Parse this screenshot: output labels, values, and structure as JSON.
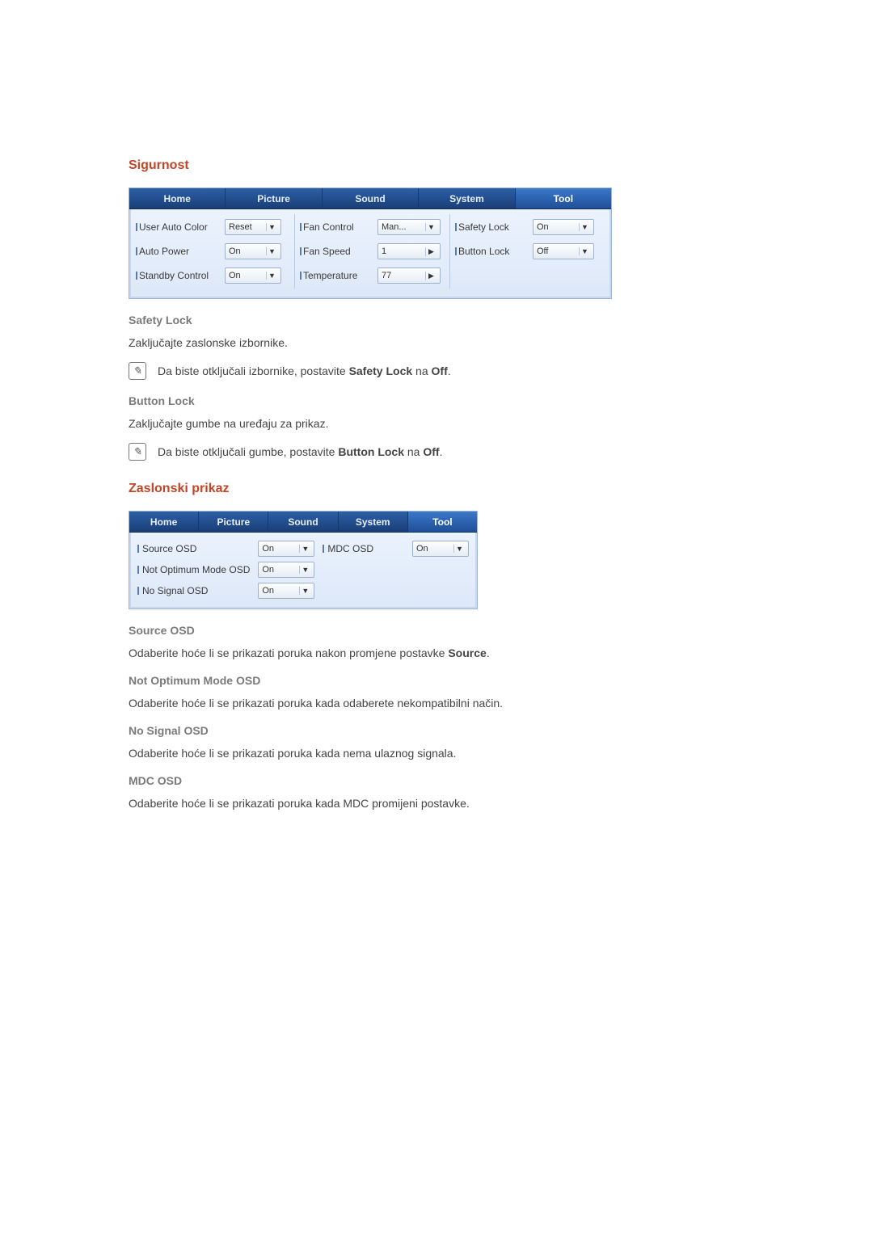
{
  "section1": {
    "title": "Sigurnost",
    "panel": {
      "tabs": [
        "Home",
        "Picture",
        "Sound",
        "System",
        "Tool"
      ],
      "activeTab": 4,
      "col1": {
        "userAutoColor": {
          "label": "User Auto Color",
          "value": "Reset"
        },
        "autoPower": {
          "label": "Auto Power",
          "value": "On"
        },
        "standbyControl": {
          "label": "Standby Control",
          "value": "On"
        }
      },
      "col2": {
        "fanControl": {
          "label": "Fan Control",
          "value": "Man..."
        },
        "fanSpeed": {
          "label": "Fan Speed",
          "value": "1"
        },
        "temperature": {
          "label": "Temperature",
          "value": "77"
        }
      },
      "col3": {
        "safetyLock": {
          "label": "Safety Lock",
          "value": "On"
        },
        "buttonLock": {
          "label": "Button Lock",
          "value": "Off"
        }
      }
    },
    "safetyLock": {
      "heading": "Safety Lock",
      "body": "Zaključajte zaslonske izbornike.",
      "note_pre": "Da biste otključali izbornike, postavite ",
      "note_bold1": "Safety Lock",
      "note_mid": " na ",
      "note_bold2": "Off",
      "note_post": "."
    },
    "buttonLock": {
      "heading": "Button Lock",
      "body": "Zaključajte gumbe na uređaju za prikaz.",
      "note_pre": "Da biste otključali gumbe, postavite ",
      "note_bold1": "Button Lock",
      "note_mid": " na ",
      "note_bold2": "Off",
      "note_post": "."
    }
  },
  "section2": {
    "title": "Zaslonski prikaz",
    "panel": {
      "tabs": [
        "Home",
        "Picture",
        "Sound",
        "System",
        "Tool"
      ],
      "activeTab": 4,
      "fields": {
        "sourceOsd": {
          "label": "Source OSD",
          "value": "On"
        },
        "mdcOsd": {
          "label": "MDC OSD",
          "value": "On"
        },
        "notOptimum": {
          "label": "Not Optimum Mode OSD",
          "value": "On"
        },
        "noSignal": {
          "label": "No Signal OSD",
          "value": "On"
        }
      }
    },
    "sourceOsd": {
      "heading": "Source OSD",
      "body_pre": "Odaberite hoće li se prikazati poruka nakon promjene postavke ",
      "body_bold": "Source",
      "body_post": "."
    },
    "notOptimum": {
      "heading": "Not Optimum Mode OSD",
      "body": "Odaberite hoće li se prikazati poruka kada odaberete nekompatibilni način."
    },
    "noSignal": {
      "heading": "No Signal OSD",
      "body": "Odaberite hoće li se prikazati poruka kada nema ulaznog signala."
    },
    "mdcOsd": {
      "heading": "MDC OSD",
      "body": "Odaberite hoće li se prikazati poruka kada MDC promijeni postavke."
    }
  }
}
